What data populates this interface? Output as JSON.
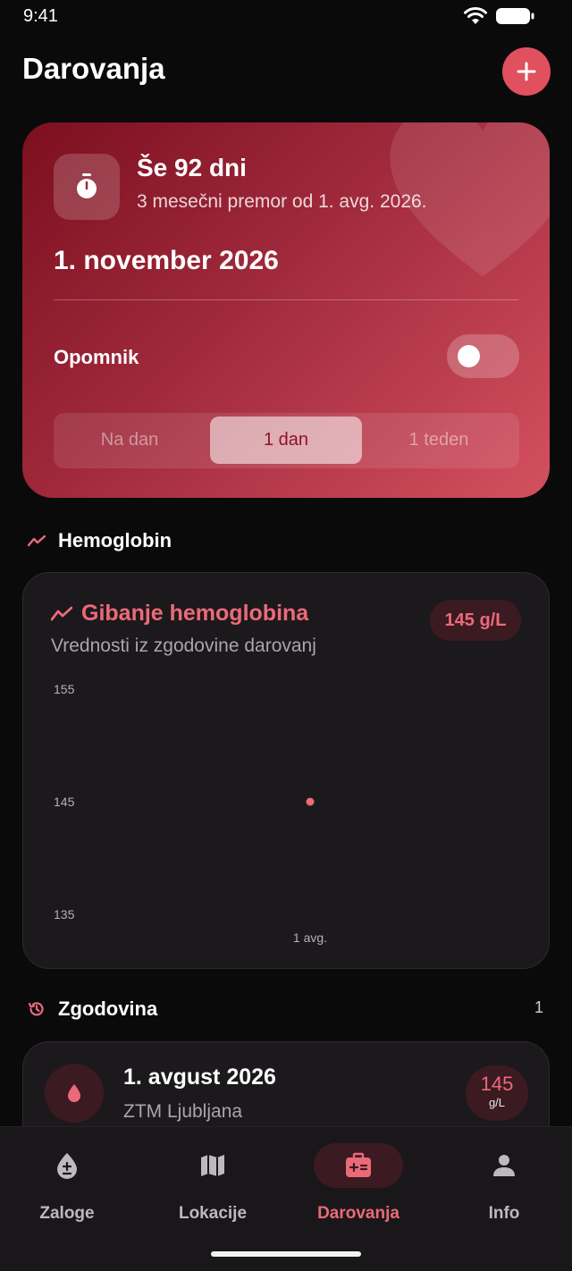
{
  "status_bar": {
    "time": "9:41"
  },
  "header": {
    "title": "Darovanja",
    "add_icon": "plus-icon"
  },
  "next_donation": {
    "countdown": "Še 92 dni",
    "break_info": "3 mesečni premor od 1. avg. 2026.",
    "date": "1. november 2026",
    "reminder_label": "Opomnik",
    "reminder_enabled": false,
    "reminder_options": [
      "Na dan",
      "1 dan",
      "1 teden"
    ],
    "selected_option": "1 dan",
    "icon": "stopwatch-icon"
  },
  "hemoglobin_section": {
    "title": "Hemoglobin",
    "card_title": "Gibanje hemoglobina",
    "card_subtitle": "Vrednosti iz zgodovine darovanj",
    "latest_value": "145 g/L",
    "icon": "trend-icon"
  },
  "chart_data": {
    "type": "scatter",
    "x": [
      "1 avg."
    ],
    "values": [
      145
    ],
    "ylim": [
      135,
      155
    ],
    "yticks": [
      "155",
      "145",
      "135"
    ],
    "xticks": [
      "1 avg."
    ],
    "accent": "#ec6a78",
    "grid": false
  },
  "history_section": {
    "title": "Zgodovina",
    "count": "1",
    "icon": "history-icon",
    "items": [
      {
        "date": "1. avgust 2026",
        "location": "ZTM Ljubljana",
        "hb_value": "145",
        "hb_unit": "g/L"
      }
    ]
  },
  "nav": {
    "items": [
      {
        "label": "Zaloge",
        "icon": "blood-drop-icon",
        "active": false
      },
      {
        "label": "Lokacije",
        "icon": "map-icon",
        "active": false
      },
      {
        "label": "Darovanja",
        "icon": "medical-kit-icon",
        "active": true
      },
      {
        "label": "Info",
        "icon": "person-icon",
        "active": false
      }
    ]
  },
  "colors": {
    "accent": "#e0505f",
    "background": "#0b0a0b",
    "card": "#1c191c"
  }
}
